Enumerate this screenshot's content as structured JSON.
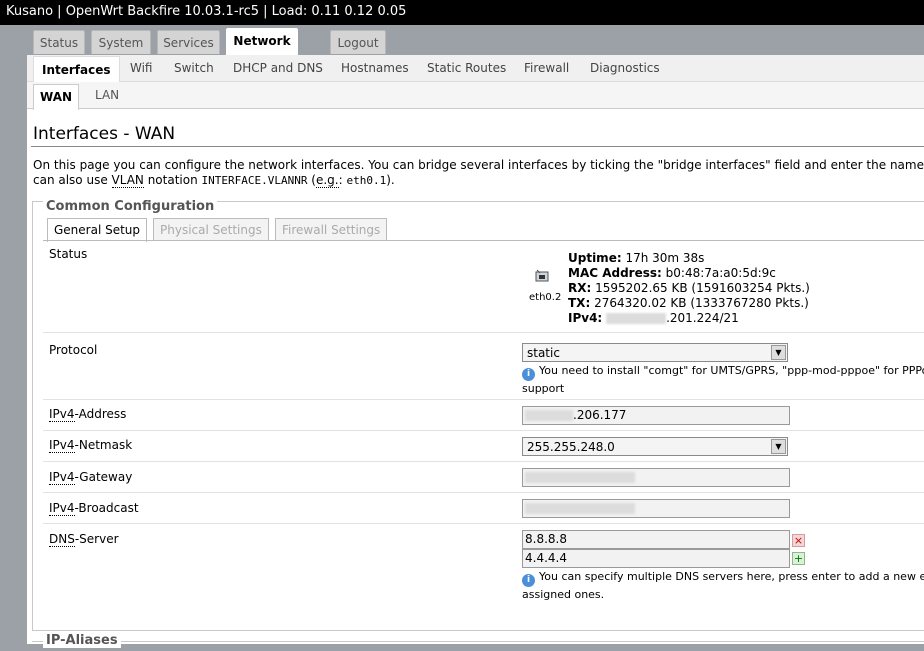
{
  "topbar": {
    "text": "Kusano | OpenWrt Backfire 10.03.1-rc5 | Load: 0.11 0.12 0.05"
  },
  "main_tabs": [
    "Status",
    "System",
    "Services",
    "Network",
    "Logout"
  ],
  "network_tabs": [
    "Interfaces",
    "Wifi",
    "Switch",
    "DHCP and DNS",
    "Hostnames",
    "Static Routes",
    "Firewall",
    "Diagnostics"
  ],
  "interface_tabs": [
    "WAN",
    "LAN"
  ],
  "page": {
    "title": "Interfaces - WAN",
    "desc_line1": "On this page you can configure the network interfaces. You can bridge several interfaces by ticking the \"bridge interfaces\" field and enter the names o",
    "desc_l2_a": "can also use ",
    "desc_l2_vlan": "VLAN",
    "desc_l2_b": " notation ",
    "desc_l2_code": "INTERFACE.VLANNR",
    "desc_l2_c": " (",
    "desc_l2_eg": "e.g.",
    "desc_l2_d": ": ",
    "desc_l2_code2": "eth0.1",
    "desc_l2_e": ")."
  },
  "config": {
    "legend": "Common Configuration",
    "subtabs": [
      "General Setup",
      "Physical Settings",
      "Firewall Settings"
    ],
    "status": {
      "label": "Status",
      "iface": "eth0.2",
      "uptime_label": "Uptime:",
      "uptime": "17h 30m 38s",
      "mac_label": "MAC Address:",
      "mac": "b0:48:7a:a0:5d:9c",
      "rx_label": "RX:",
      "rx": "1595202.65 KB (1591603254 Pkts.)",
      "tx_label": "TX:",
      "tx": "2764320.02 KB (1333767280 Pkts.)",
      "ipv4_label": "IPv4:",
      "ipv4_visible": ".201.224/21"
    },
    "protocol": {
      "label": "Protocol",
      "value": "static",
      "hint_line1": "You need to install \"comgt\" for UMTS/GPRS, \"ppp-mod-pppoe\" for PPPo",
      "hint_line2": "support"
    },
    "ipv4_address": {
      "label_abbr": "IPv4",
      "label_rest": "-Address",
      "value_visible": ".206.177"
    },
    "ipv4_netmask": {
      "label_abbr": "IPv4",
      "label_rest": "-Netmask",
      "value": "255.255.248.0"
    },
    "ipv4_gateway": {
      "label_abbr": "IPv4",
      "label_rest": "-Gateway"
    },
    "ipv4_broadcast": {
      "label_abbr": "IPv4",
      "label_rest": "-Broadcast"
    },
    "dns": {
      "label_abbr": "DNS",
      "label_rest": "-Server",
      "servers": [
        "8.8.8.8",
        "4.4.4.4"
      ],
      "hint_line1": "You can specify multiple DNS servers here, press enter to add a new en",
      "hint_line2": "assigned ones."
    }
  },
  "aliases": {
    "legend": "IP-Aliases"
  },
  "icons": {
    "info": "info-icon",
    "delete": "delete-icon",
    "add": "add-icon",
    "ethernet": "ethernet-port-icon"
  }
}
